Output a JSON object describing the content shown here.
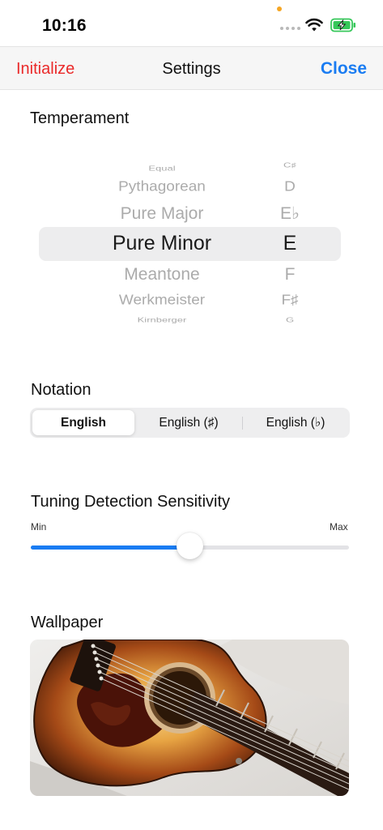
{
  "status_bar": {
    "time": "10:16"
  },
  "nav": {
    "left_label": "Initialize",
    "title": "Settings",
    "right_label": "Close"
  },
  "temperament": {
    "title": "Temperament",
    "names": [
      "Equal",
      "Pythagorean",
      "Pure Major",
      "Pure Minor",
      "Meantone",
      "Werkmeister",
      "Kirnberger"
    ],
    "notes": [
      "C♯",
      "D",
      "E♭",
      "E",
      "F",
      "F♯",
      "G"
    ],
    "selected_name": "Pure Minor",
    "selected_note": "E"
  },
  "notation": {
    "title": "Notation",
    "options": [
      "English",
      "English (♯)",
      "English (♭)"
    ],
    "selected": "English"
  },
  "sensitivity": {
    "title": "Tuning Detection Sensitivity",
    "min_label": "Min",
    "max_label": "Max",
    "value_fraction": 0.5
  },
  "wallpaper": {
    "title": "Wallpaper"
  },
  "colors": {
    "accent": "#1a7cf2",
    "destructive": "#ea2a2a",
    "battery": "#35c759",
    "wheel_inactive": "#ababab"
  },
  "icons": [
    "wifi-icon",
    "battery-charging-icon",
    "cellular-signal-icon"
  ]
}
